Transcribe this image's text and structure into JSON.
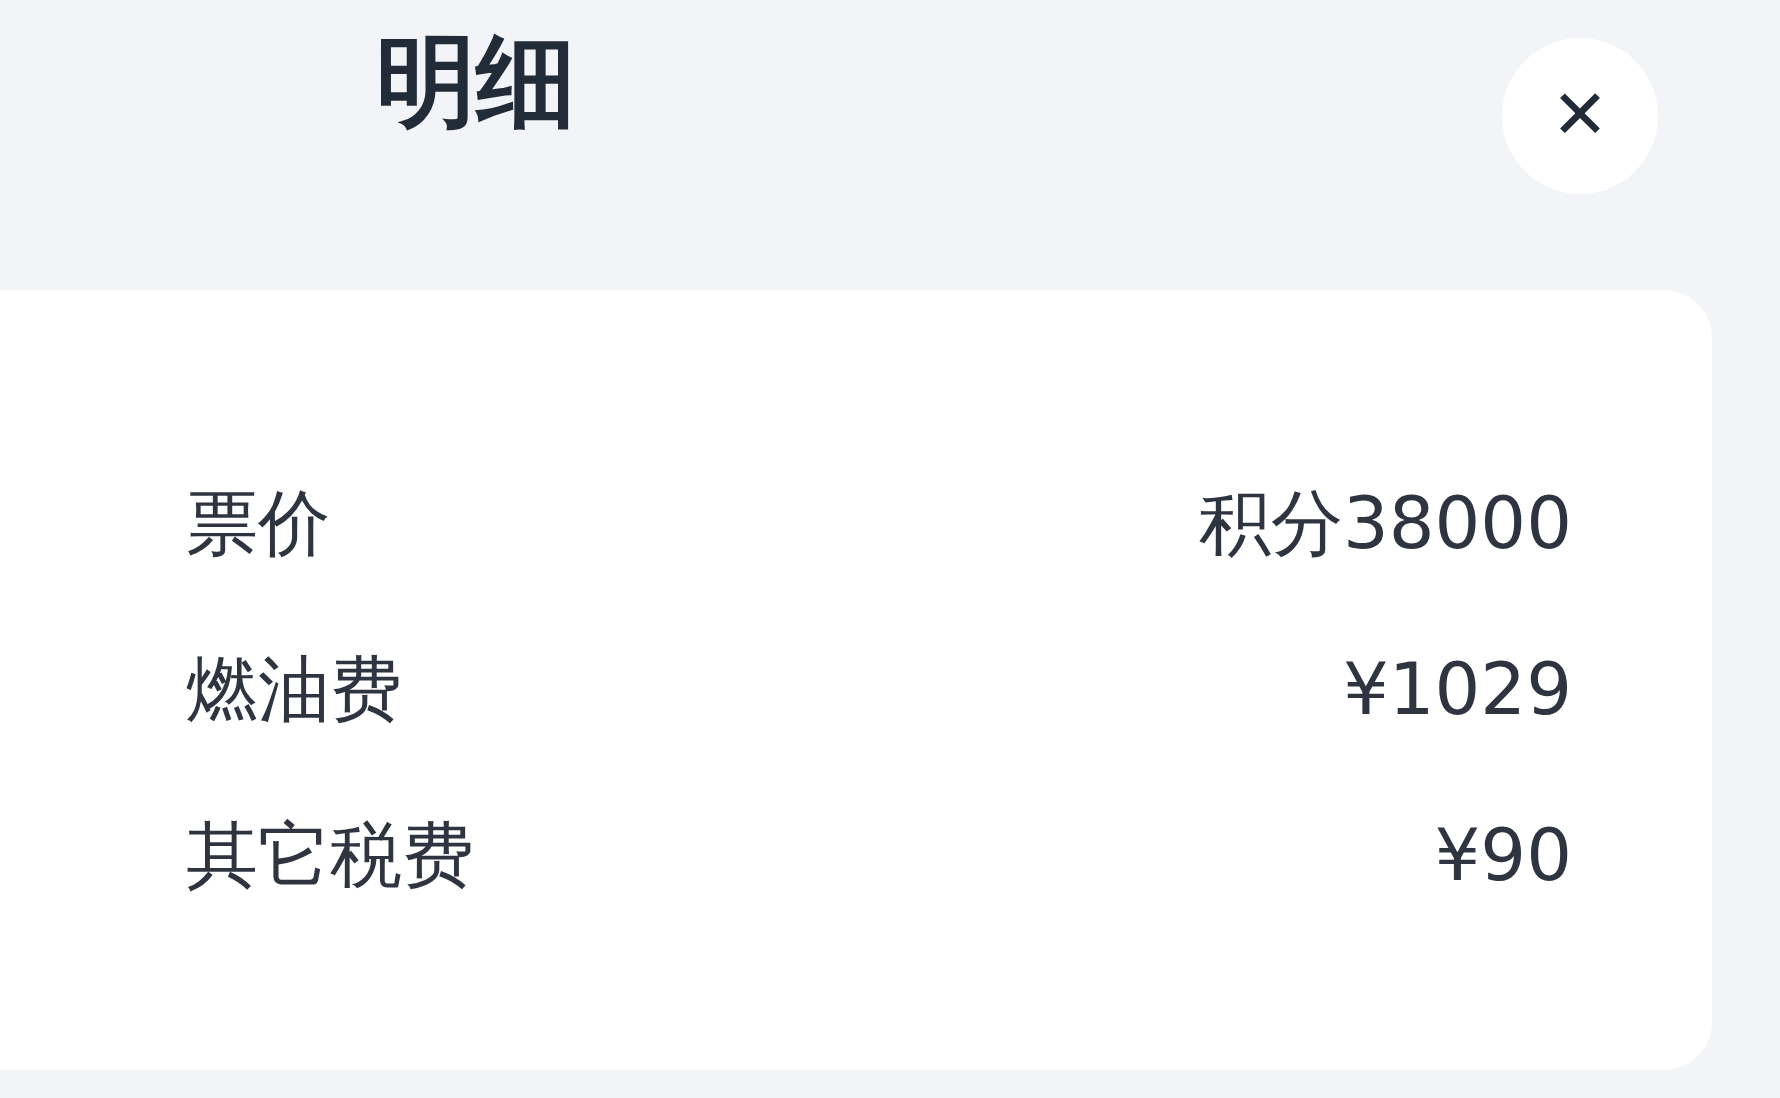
{
  "header": {
    "title": "明细",
    "close_label": "✕"
  },
  "rows": [
    {
      "label": "票价",
      "value": "积分38000"
    },
    {
      "label": "燃油费",
      "value": "¥1029"
    },
    {
      "label": "其它税费",
      "value": "¥90"
    }
  ]
}
